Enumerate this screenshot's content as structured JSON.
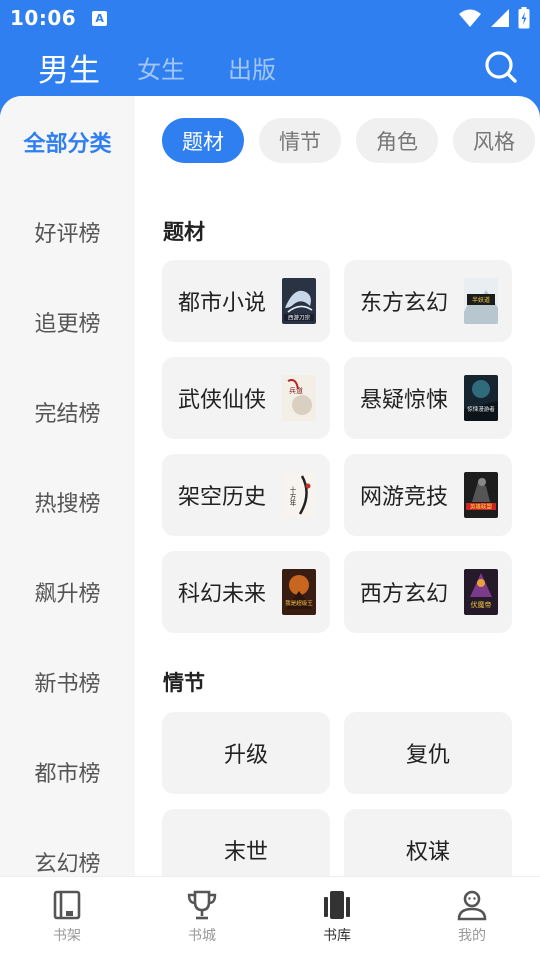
{
  "status": {
    "time": "10:06",
    "app_icon_letter": "A"
  },
  "header": {
    "tabs": [
      {
        "label": "男生",
        "active": true
      },
      {
        "label": "女生",
        "active": false
      },
      {
        "label": "出版",
        "active": false
      }
    ],
    "search_icon": "search-icon"
  },
  "sidebar": {
    "items": [
      {
        "label": "全部分类",
        "active": true
      },
      {
        "label": "好评榜"
      },
      {
        "label": "追更榜"
      },
      {
        "label": "完结榜"
      },
      {
        "label": "热搜榜"
      },
      {
        "label": "飙升榜"
      },
      {
        "label": "新书榜"
      },
      {
        "label": "都市榜"
      },
      {
        "label": "玄幻榜"
      }
    ]
  },
  "filters": {
    "chips": [
      {
        "label": "题材",
        "active": true
      },
      {
        "label": "情节"
      },
      {
        "label": "角色"
      },
      {
        "label": "风格"
      }
    ]
  },
  "sections": [
    {
      "title": "题材",
      "cards": [
        {
          "label": "都市小说",
          "cover_text": "西游刀宗"
        },
        {
          "label": "东方玄幻",
          "cover_text": "半妖道"
        },
        {
          "label": "武侠仙侠",
          "cover_text": "兵道"
        },
        {
          "label": "悬疑惊悚",
          "cover_text": "惊悚漫游者"
        },
        {
          "label": "架空历史",
          "cover_text": "十方年"
        },
        {
          "label": "网游竞技",
          "cover_text": "英雄联盟"
        },
        {
          "label": "科幻未来",
          "cover_text": "我是超级王"
        },
        {
          "label": "西方玄幻",
          "cover_text": "伏魔帝"
        }
      ]
    },
    {
      "title": "情节",
      "cards": [
        {
          "label": "升级"
        },
        {
          "label": "复仇"
        },
        {
          "label": "末世"
        },
        {
          "label": "权谋"
        }
      ]
    }
  ],
  "bottom_nav": {
    "items": [
      {
        "label": "书架",
        "icon": "bookshelf-icon",
        "active": false
      },
      {
        "label": "书城",
        "icon": "trophy-icon",
        "active": false
      },
      {
        "label": "书库",
        "icon": "library-icon",
        "active": true
      },
      {
        "label": "我的",
        "icon": "profile-icon",
        "active": false
      }
    ]
  },
  "colors": {
    "accent": "#2f7ff0",
    "sidebar_bg": "#f6f6f6",
    "card_bg": "#f3f3f3",
    "chip_bg": "#f0f0f0"
  }
}
